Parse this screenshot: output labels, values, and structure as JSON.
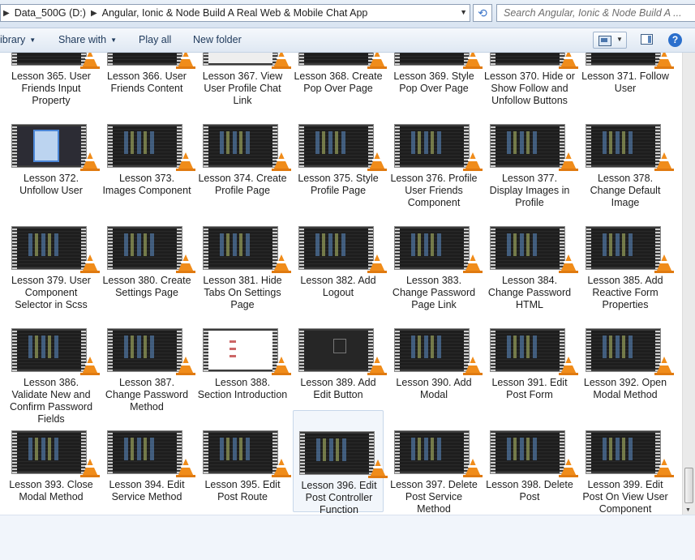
{
  "address": {
    "crumbs": [
      "Data_500G (D:)",
      "Angular, Ionic & Node Build A Real Web & Mobile Chat App"
    ],
    "search_placeholder": "Search Angular, Ionic & Node Build A ..."
  },
  "toolbar": {
    "library_label": "ibrary",
    "share_label": "Share with",
    "play_label": "Play all",
    "newfolder_label": "New folder"
  },
  "icons": {
    "video_overlay": "vlc-cone-icon",
    "refresh": "refresh-icon",
    "help": "help-icon"
  },
  "files": [
    {
      "label": "Lesson 365. User Friends Input Property",
      "thumb": "code"
    },
    {
      "label": "Lesson 366. User Friends Content",
      "thumb": "code"
    },
    {
      "label": "Lesson 367. View User Profile Chat Link",
      "thumb": "white"
    },
    {
      "label": "Lesson 368. Create Pop Over Page",
      "thumb": "code"
    },
    {
      "label": "Lesson 369. Style Pop Over Page",
      "thumb": "code"
    },
    {
      "label": "Lesson 370. Hide or Show Follow and Unfollow Buttons",
      "thumb": "code"
    },
    {
      "label": "Lesson 371. Follow User",
      "thumb": "code"
    },
    {
      "label": "Lesson 372. Unfollow User",
      "thumb": "blue"
    },
    {
      "label": "Lesson 373. Images Component",
      "thumb": "code"
    },
    {
      "label": "Lesson 374. Create Profile Page",
      "thumb": "code"
    },
    {
      "label": "Lesson 375. Style Profile Page",
      "thumb": "code"
    },
    {
      "label": "Lesson 376. Profile User Friends Component",
      "thumb": "code"
    },
    {
      "label": "Lesson 377. Display Images in Profile",
      "thumb": "code"
    },
    {
      "label": "Lesson 378. Change Default Image",
      "thumb": "code"
    },
    {
      "label": "Lesson 379. User Component Selector in Scss",
      "thumb": "code"
    },
    {
      "label": "Lesson 380. Create Settings Page",
      "thumb": "code"
    },
    {
      "label": "Lesson 381. Hide Tabs On Settings Page",
      "thumb": "code"
    },
    {
      "label": "Lesson 382. Add Logout",
      "thumb": "code"
    },
    {
      "label": "Lesson 383. Change Password Page Link",
      "thumb": "code"
    },
    {
      "label": "Lesson 384. Change Password HTML",
      "thumb": "code"
    },
    {
      "label": "Lesson 385. Add Reactive Form Properties",
      "thumb": "code"
    },
    {
      "label": "Lesson 386. Validate New and Confirm Password Fields",
      "thumb": "code"
    },
    {
      "label": "Lesson 387. Change Password Method",
      "thumb": "code"
    },
    {
      "label": "Lesson 388. Section Introduction",
      "thumb": "light"
    },
    {
      "label": "Lesson 389. Add Edit Button",
      "thumb": "dark"
    },
    {
      "label": "Lesson 390. Add Modal",
      "thumb": "code"
    },
    {
      "label": "Lesson 391. Edit Post Form",
      "thumb": "code"
    },
    {
      "label": "Lesson 392. Open Modal Method",
      "thumb": "code"
    },
    {
      "label": "Lesson 393. Close Modal Method",
      "thumb": "code"
    },
    {
      "label": "Lesson 394. Edit Service Method",
      "thumb": "code"
    },
    {
      "label": "Lesson 395. Edit Post Route",
      "thumb": "code"
    },
    {
      "label": "Lesson 396. Edit Post Controller Function",
      "thumb": "code",
      "selected": true
    },
    {
      "label": "Lesson 397. Delete Post Service Method",
      "thumb": "code"
    },
    {
      "label": "Lesson 398. Delete Post",
      "thumb": "code"
    },
    {
      "label": "Lesson 399. Edit Post On View User Component",
      "thumb": "code"
    }
  ]
}
